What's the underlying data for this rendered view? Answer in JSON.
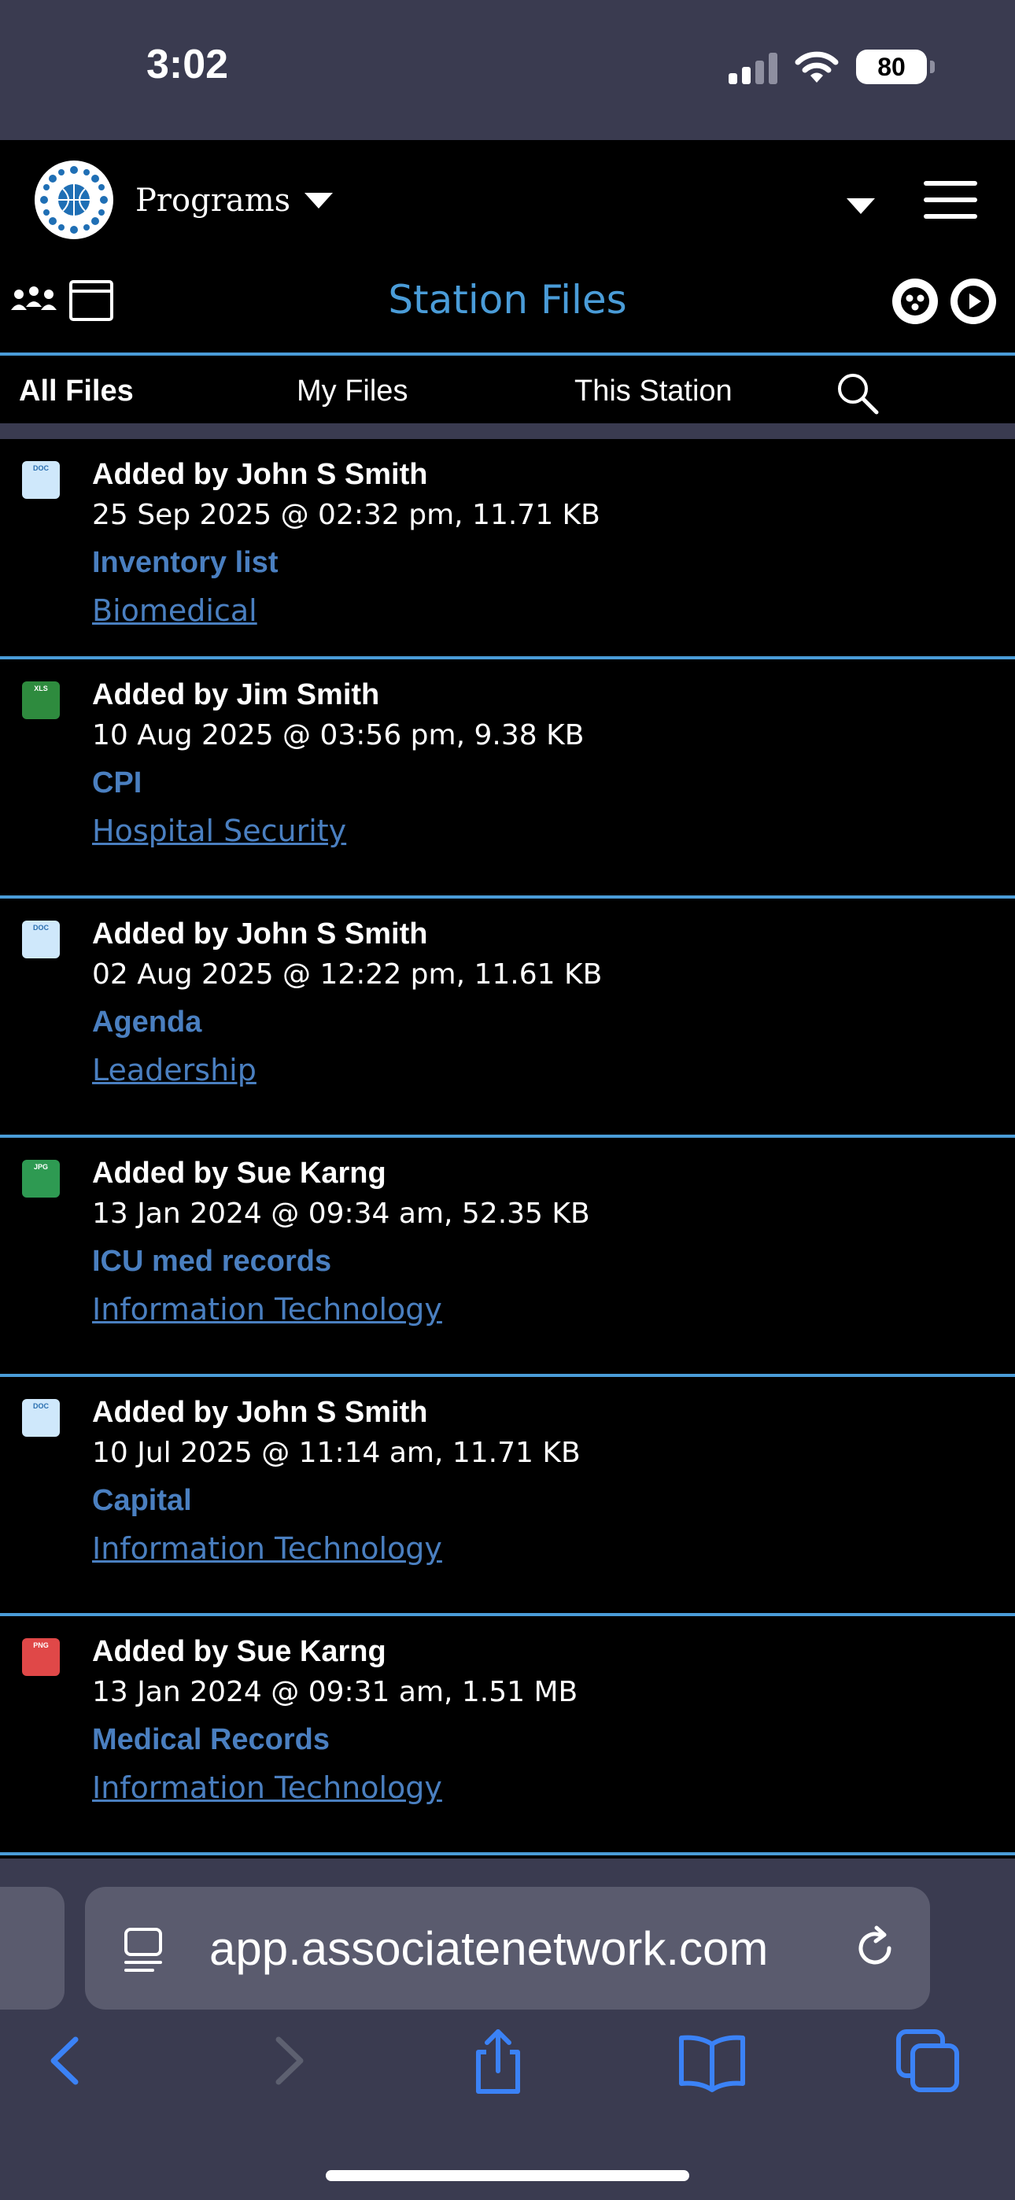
{
  "status_bar": {
    "time": "3:02",
    "battery": "80"
  },
  "header": {
    "programs_label": "Programs",
    "logo_icon": "globe-people-icon",
    "menu_icon": "hamburger-icon"
  },
  "title_bar": {
    "title": "Station Files",
    "left_icons": [
      "people-icon",
      "window-icon"
    ],
    "right_icons": [
      "dots-icon",
      "play-icon"
    ]
  },
  "tabs": {
    "all": "All Files",
    "mine": "My Files",
    "station": "This Station",
    "active": "All Files"
  },
  "files": [
    {
      "type": "DOC",
      "added_by": "Added by John S Smith",
      "meta": "25 Sep 2025 @ 02:32 pm, 11.71 KB",
      "name": "Inventory list",
      "folder": "Biomedical"
    },
    {
      "type": "XLS",
      "added_by": "Added by Jim Smith",
      "meta": "10 Aug 2025 @ 03:56 pm, 9.38 KB",
      "name": "CPI",
      "folder": "Hospital Security"
    },
    {
      "type": "DOC",
      "added_by": "Added by John S Smith",
      "meta": "02 Aug 2025 @ 12:22 pm, 11.61 KB",
      "name": "Agenda",
      "folder": "Leadership"
    },
    {
      "type": "JPG",
      "added_by": "Added by Sue Karng",
      "meta": "13 Jan 2024 @ 09:34 am, 52.35 KB",
      "name": "ICU med records",
      "folder": "Information Technology"
    },
    {
      "type": "DOC",
      "added_by": "Added by John S Smith",
      "meta": "10 Jul 2025 @ 11:14 am, 11.71 KB",
      "name": "Capital",
      "folder": "Information Technology"
    },
    {
      "type": "PNG",
      "added_by": "Added by Sue Karng",
      "meta": "13 Jan 2024 @ 09:31 am, 1.51 MB",
      "name": "Medical Records",
      "folder": "Information Technology"
    }
  ],
  "browser": {
    "url": "app.associatenetwork.com",
    "toolbar_icons": [
      "back-icon",
      "forward-icon",
      "share-icon",
      "bookmarks-icon",
      "tabs-icon"
    ]
  },
  "colors": {
    "accent": "#4a9cd8",
    "link": "#4a7fc0",
    "chrome": "#3a3b50",
    "background": "#000000"
  }
}
